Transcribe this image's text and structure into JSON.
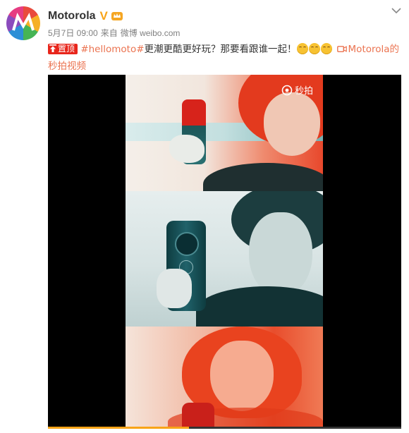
{
  "post": {
    "username": "Motorola",
    "date": "5月7日 09:00",
    "source_prefix": "来自",
    "source": "微博 weibo.com",
    "pin_label": "置顶",
    "hashtag": "#hellomoto#",
    "body_text": "更潮更酷更好玩？那要看跟谁一起！",
    "link_label": "Motorola的秒拍视频"
  },
  "video": {
    "watermark_text": "秒拍",
    "progress_fraction": 0.4
  },
  "icons": {
    "verified": "verified-v-icon",
    "member": "member-crown-icon",
    "menu": "chevron-down-icon",
    "pin": "pin-top-icon",
    "emoji": "smile-emoji-icon",
    "video_link": "video-camera-icon",
    "watermark": "miaopai-icon"
  },
  "colors": {
    "hashtag": "#eb7350",
    "pin_badge": "#e8251b",
    "verified": "#f8a418",
    "meta_text": "#808080",
    "body_text": "#333333"
  }
}
